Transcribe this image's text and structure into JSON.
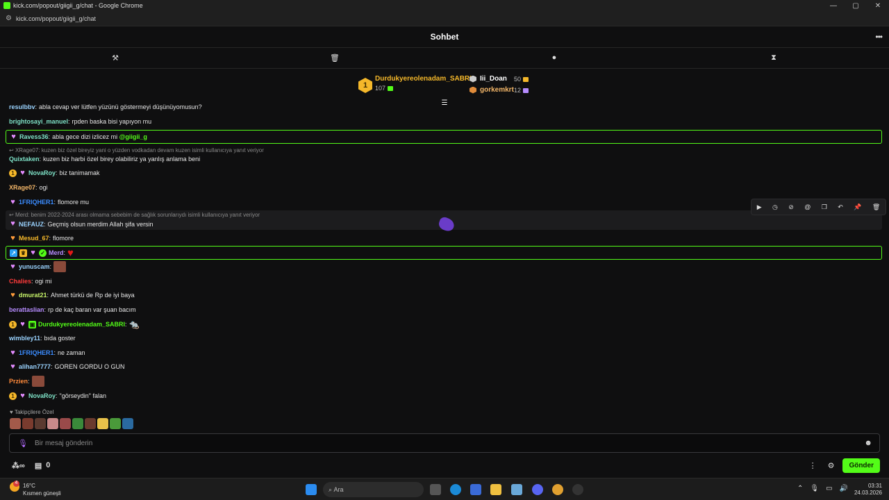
{
  "window": {
    "title": "kick.com/popout/giigii_g/chat - Google Chrome",
    "url": "kick.com/popout/giigii_g/chat"
  },
  "header": {
    "title": "Sohbet"
  },
  "leaderboard": {
    "first": {
      "rank": "1",
      "name": "Durdukyereolenadam_SABRI",
      "count": "107"
    },
    "second": {
      "name": "Iii_Doan",
      "count": "50"
    },
    "third": {
      "name": "gorkemkrt",
      "count": "12"
    }
  },
  "messages": [
    {
      "user": "resulbbv",
      "text": "abla cevap ver lütfen yüzünü göstermeyi düşünüyomusun?",
      "color": "#9ad3ff"
    },
    {
      "user": "brightosayi_manuel",
      "text": "rpden baska bisi yapıyon mu",
      "color": "#7fe3c8"
    },
    {
      "user": "Ravess36",
      "text": "abla gece dizi izlicez mi ",
      "mention": "@giigii_g",
      "color": "#7fe3c8"
    },
    {
      "reply": "XRage07: kuzen biz özel bireyiz yani o yüzden vodkadan devam kuzen isimli kullanıcıya yanıt veriyor",
      "user": "Quixtaken",
      "text": "kuzen biz harbi özel birey olabiliriz ya yanlış anlama beni",
      "color": "#7fe3c8"
    },
    {
      "user": "NovaRoy",
      "text": "biz tanimamak",
      "color": "#7fe3c8"
    },
    {
      "user": "XRage07",
      "text": "ogi",
      "color": "#f5b86a"
    },
    {
      "user": "1FRIQHER1",
      "text": "flomore mu",
      "color": "#3b8cff"
    },
    {
      "reply": "Merd: benim 2022-2024 arası olmama sebebim de sağlık sorunlarıydı isimli kullanıcıya yanıt veriyor",
      "user": "NEFAUZ",
      "text": "Geçmiş olsun merdim Allah şifa versin",
      "color": "#9ad3ff"
    },
    {
      "user": "Mesud_67",
      "text": "flomore",
      "color": "#f5b82a"
    },
    {
      "user": "Merd",
      "text": "",
      "color": "#b68cff"
    },
    {
      "user": "yunuscam",
      "text": "",
      "color": "#9ad3ff"
    },
    {
      "user": "Chalies",
      "text": "ogi mi",
      "color": "#ff3b3b"
    },
    {
      "user": "dmurat21",
      "text": "Ahmet türkü de Rp de iyi baya",
      "color": "#c8f56a"
    },
    {
      "user": "berattaslian",
      "text": "rp de kaç baran var şuan bacım",
      "color": "#b68cff"
    },
    {
      "user": "Durdukyereolenadam_SABRI",
      "text": "",
      "color": "#53fc18"
    },
    {
      "user": "wimbley11",
      "text": "bıda goster",
      "color": "#9ad3ff"
    },
    {
      "user": "1FRIQHER1",
      "text": "ne zaman",
      "color": "#3b8cff"
    },
    {
      "user": "alihan7777",
      "text": "GOREN GORDU O GUN",
      "color": "#9ad3ff"
    },
    {
      "user": "Przien",
      "text": "",
      "color": "#ff8a3b"
    },
    {
      "user": "NovaRoy",
      "text": "\"görseydin\" falan",
      "color": "#7fe3c8"
    }
  ],
  "follower_label": "Takipçilere Özel",
  "input": {
    "placeholder": "Bir mesaj gönderin"
  },
  "footer": {
    "points": "0",
    "send_label": "Gönder"
  },
  "taskbar": {
    "temp": "16°C",
    "weather": "Kısmen güneşli",
    "search": "Ara",
    "time": "03:31",
    "date": "24.03.2026",
    "weather_badge": "4"
  },
  "colors": {
    "accent": "#53fc18",
    "background": "#0f0f10",
    "gold": "#f5b82a"
  }
}
